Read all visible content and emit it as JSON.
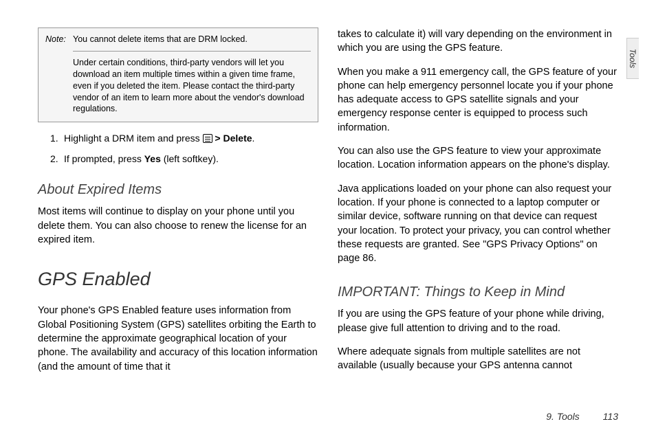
{
  "sideTab": "Tools",
  "note": {
    "label": "Note:",
    "line1": "You cannot delete items that are DRM locked.",
    "line2": "Under certain conditions, third-party vendors will let you download an item multiple times within a given time frame, even if you deleted the item. Please contact the third-party vendor of an item to learn more about the vendor's download regulations."
  },
  "steps": {
    "s1_pre": "Highlight a DRM item and press ",
    "s1_gt": " > ",
    "s1_delete": "Delete",
    "s1_end": ".",
    "s2_pre": "If prompted, press ",
    "s2_yes": "Yes",
    "s2_end": " (left softkey)."
  },
  "sub1": "About Expired Items",
  "p1": "Most items will continue to display on your phone until you delete them. You can also choose to renew the license for an expired item.",
  "h1": "GPS Enabled",
  "p2": "Your phone's GPS Enabled feature uses information from Global Positioning System (GPS) satellites orbiting the Earth to determine the approximate geographical location of your phone. The availability and accuracy of this location information (and the amount of time that it",
  "p3": "takes to calculate it) will vary depending on the environment in which you are using the GPS feature.",
  "p4": "When you make a 911 emergency call, the GPS feature of your phone can help emergency personnel locate you if your phone has adequate access to GPS satellite signals and your emergency response center is equipped to process such information.",
  "p5": "You can also use the GPS feature to view your approximate location. Location information appears on the phone's display.",
  "p6": "Java applications loaded on your phone can also request your location. If your phone is connected to a laptop computer or similar device, software running on that device can request your location. To protect your privacy, you can control whether these requests are granted. See \"GPS Privacy Options\" on page 86.",
  "sub2": "IMPORTANT: Things to Keep in Mind",
  "p7": "If you are using the GPS feature of your phone while driving, please give full attention to driving and to the road.",
  "p8": "Where adequate signals from multiple satellites are not available (usually because your GPS antenna cannot",
  "footer": {
    "chapter": "9. Tools",
    "page": "113"
  }
}
